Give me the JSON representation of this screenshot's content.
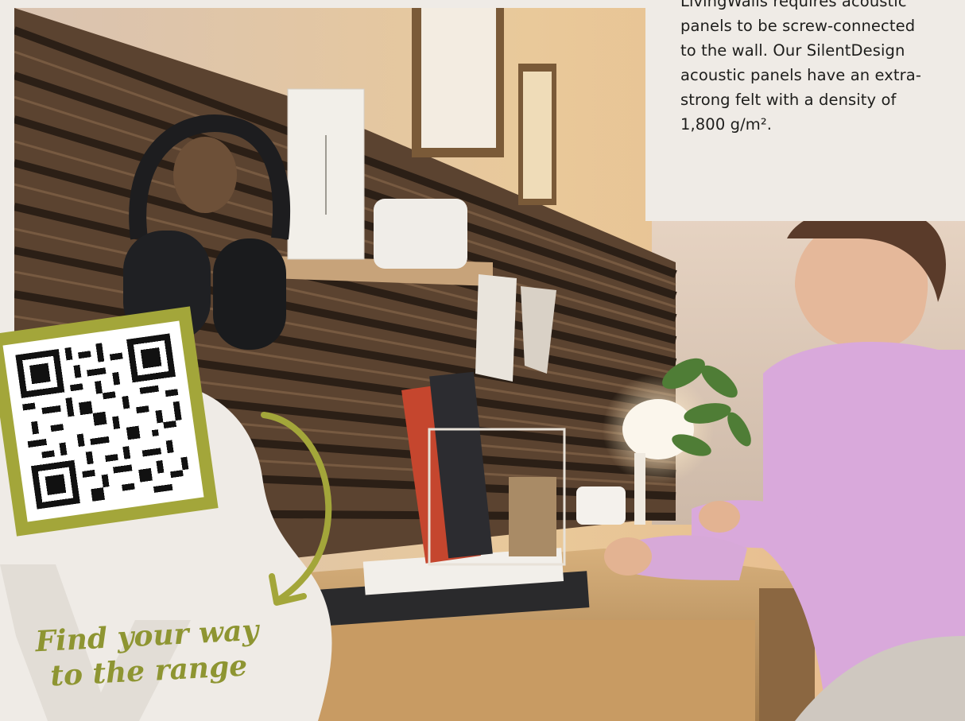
{
  "info": {
    "lines": [
      "LivingWalls requires acoustic",
      "panels to be screw-connected",
      "to the wall. Our SilentDesign",
      "acoustic panels have an extra-",
      "strong felt with a density of",
      "1,800 g/m²."
    ]
  },
  "promo": {
    "caption_line1": "Find your way",
    "caption_line2": "to the range"
  },
  "colors": {
    "accent_green": "#a3a63a",
    "caption_green": "#8e9532",
    "panel_bg": "#efebe6"
  },
  "icons": {
    "qr": "qr-code-icon",
    "arrow": "curved-arrow-icon"
  }
}
